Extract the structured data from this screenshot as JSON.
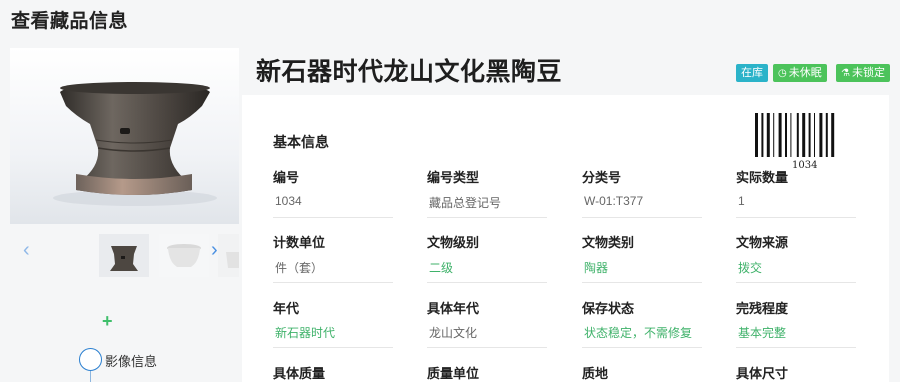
{
  "page": {
    "title": "查看藏品信息"
  },
  "item": {
    "name": "新石器时代龙山文化黑陶豆",
    "badges": {
      "status": "在库",
      "sleep": "未休眠",
      "lock": "未锁定"
    },
    "barcode_number": "1034"
  },
  "gallery": {
    "prev_icon": "chevron-left-icon",
    "next_icon": "chevron-right-icon"
  },
  "sidebar": {
    "add_icon": "plus-icon",
    "timeline_label": "影像信息"
  },
  "basic_info": {
    "title": "基本信息",
    "fields": [
      {
        "label": "编号",
        "value": "1034",
        "highlight": false
      },
      {
        "label": "编号类型",
        "value": "藏品总登记号",
        "highlight": false
      },
      {
        "label": "分类号",
        "value": "W-01:T377",
        "highlight": false
      },
      {
        "label": "实际数量",
        "value": "1",
        "highlight": false
      },
      {
        "label": "计数单位",
        "value": "件（套）",
        "highlight": false
      },
      {
        "label": "文物级别",
        "value": "二级",
        "highlight": true
      },
      {
        "label": "文物类别",
        "value": "陶器",
        "highlight": true
      },
      {
        "label": "文物来源",
        "value": "拨交",
        "highlight": true
      },
      {
        "label": "年代",
        "value": "新石器时代",
        "highlight": true
      },
      {
        "label": "具体年代",
        "value": "龙山文化",
        "highlight": false
      },
      {
        "label": "保存状态",
        "value": "状态稳定，不需修复",
        "highlight": true
      },
      {
        "label": "完残程度",
        "value": "基本完整",
        "highlight": true
      },
      {
        "label": "具体质量",
        "value": "",
        "highlight": false
      },
      {
        "label": "质量单位",
        "value": "",
        "highlight": false
      },
      {
        "label": "质地",
        "value": "",
        "highlight": false
      },
      {
        "label": "具体尺寸",
        "value": "",
        "highlight": false
      }
    ]
  },
  "colors": {
    "accent_green": "#3fb26a",
    "badge_teal": "#2bb3c9",
    "badge_green": "#4cc35b",
    "link_blue": "#4a90e2"
  }
}
